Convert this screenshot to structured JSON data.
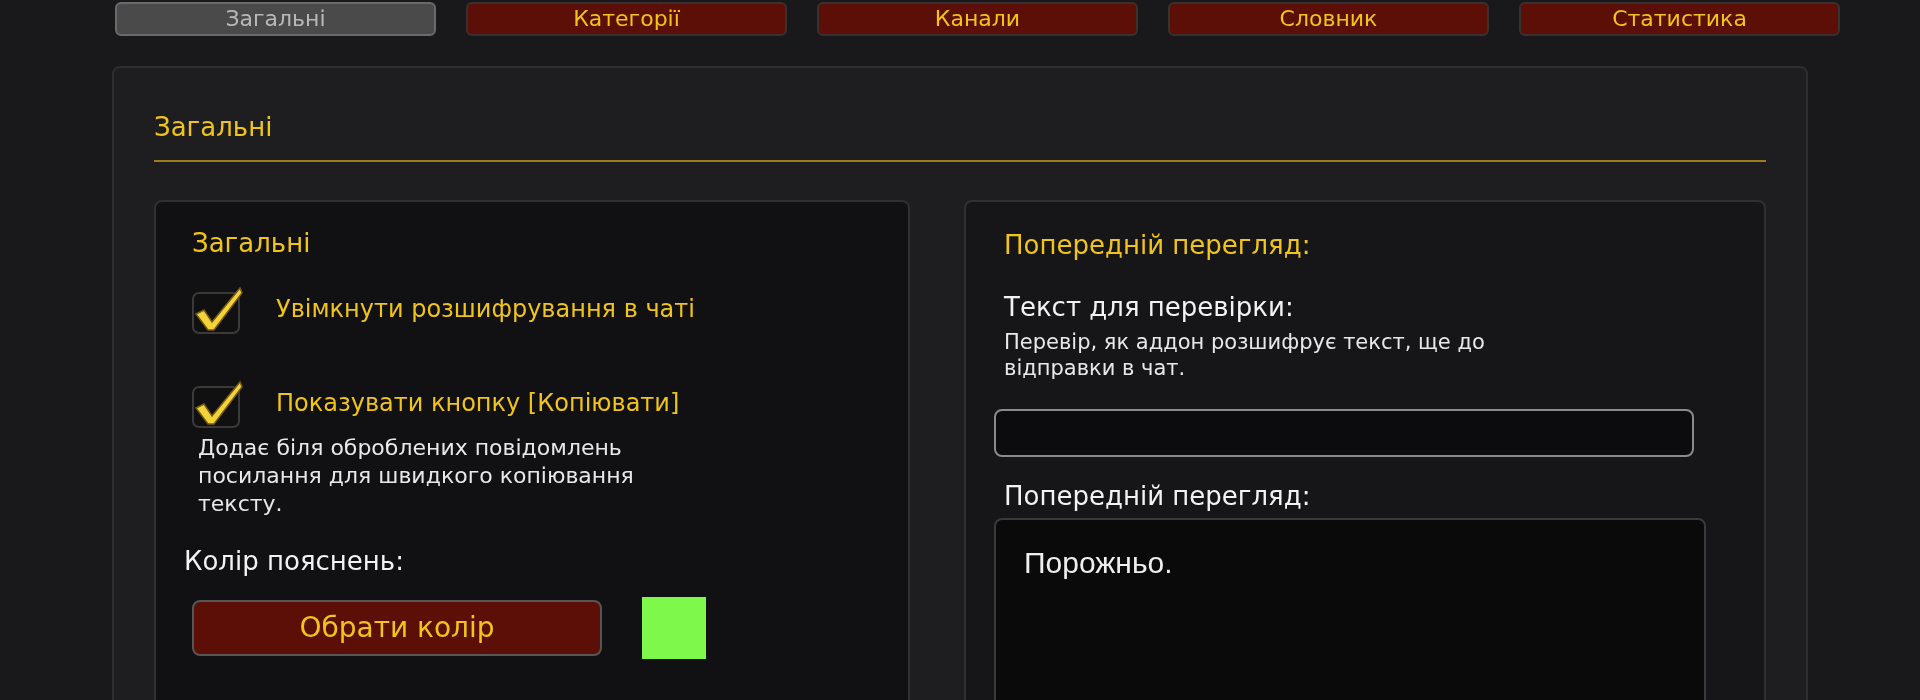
{
  "tabs": [
    {
      "label": "Загальні",
      "selected": true
    },
    {
      "label": "Категорії",
      "selected": false
    },
    {
      "label": "Канали",
      "selected": false
    },
    {
      "label": "Словник",
      "selected": false
    },
    {
      "label": "Статистика",
      "selected": false
    }
  ],
  "section_title": "Загальні",
  "general_panel": {
    "title": "Загальні",
    "options": [
      {
        "label": "Увімкнути розшифрування в чаті",
        "checked": true
      },
      {
        "label": "Показувати кнопку [Копіювати]",
        "checked": true,
        "description": "Додає біля оброблених повідомлень посилання для швидкого копіювання тексту."
      }
    ],
    "color_label": "Колір пояснень:",
    "color_button": "Обрати колір",
    "swatch": {
      "color": "#7ef84a"
    }
  },
  "preview_panel": {
    "title": "Попередній перегляд:",
    "test_label": "Текст для перевірки:",
    "test_hint": "Перевір, як аддон розшифрує текст, ще до відправки в чат.",
    "preview_label": "Попередній перегляд:",
    "preview_text": "Порожньо."
  }
}
